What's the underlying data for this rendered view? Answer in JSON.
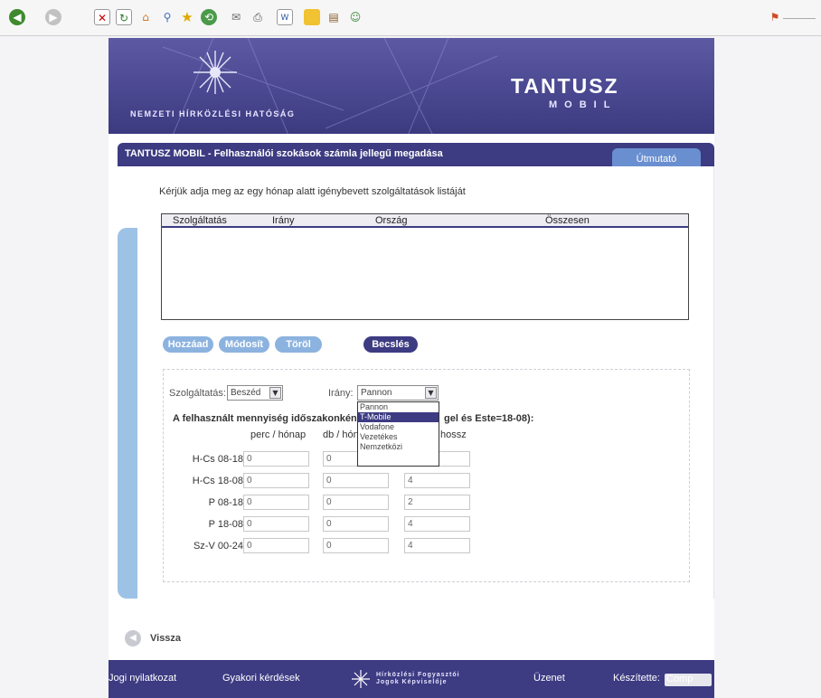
{
  "browser": {
    "toolbar_icons": [
      "back-icon",
      "forward-icon",
      "stop-icon",
      "refresh-icon",
      "home-icon",
      "search-icon",
      "favorites-icon",
      "history-icon",
      "mail-icon",
      "print-icon",
      "edit-icon",
      "folder-icon",
      "research-icon",
      "messenger-icon"
    ]
  },
  "header": {
    "org_name": "Nemzeti Hírközlési Hatóság",
    "brand_name": "TANTUSZ",
    "brand_sub": "MOBIL"
  },
  "titlebar": {
    "title": "TANTUSZ MOBIL - Felhasználói szokások számla jellegű megadása",
    "guide_tab": "Útmutató"
  },
  "main": {
    "intro": "Kérjük adja meg az egy hónap alatt igénybevett szolgáltatások listáját",
    "list_columns": [
      "Szolgáltatás",
      "Irány",
      "Ország",
      "Összesen"
    ],
    "buttons": {
      "add": "Hozzáad",
      "edit": "Módosít",
      "delete": "Töröl",
      "estimate": "Becslés"
    }
  },
  "form": {
    "service_label": "Szolgáltatás:",
    "service_value": "Beszéd",
    "direction_label": "Irány:",
    "direction_value": "Pannon",
    "direction_options": [
      "Pannon",
      "T-Mobile",
      "Vodafone",
      "Vezetékes",
      "Nemzetközi"
    ],
    "direction_highlighted": "T-Mobile",
    "quantity_title_left": "A felhasznált mennyiség időszakonként (",
    "quantity_title_right": "gel és Este=18-08):",
    "col_perc": "perc / hónap",
    "col_db": "db / hón",
    "col_hossz": "hossz",
    "rows": [
      {
        "label": "H-Cs 08-18",
        "perc": "0",
        "db": "0",
        "hossz": ""
      },
      {
        "label": "H-Cs 18-08",
        "perc": "0",
        "db": "0",
        "hossz": "4"
      },
      {
        "label": "P 08-18",
        "perc": "0",
        "db": "0",
        "hossz": "2"
      },
      {
        "label": "P 18-08",
        "perc": "0",
        "db": "0",
        "hossz": "4"
      },
      {
        "label": "Sz-V 00-24",
        "perc": "0",
        "db": "0",
        "hossz": "4"
      }
    ]
  },
  "nav": {
    "back": "Vissza"
  },
  "footer": {
    "legal": "Jogi nyilatkozat",
    "faq": "Gyakori kérdések",
    "logo_line1": "Hírközlési Fogyasztói",
    "logo_line2": "Jogok Képviselője",
    "message": "Üzenet",
    "made_by": "Készítette:",
    "made_by_badge": "Comp"
  }
}
